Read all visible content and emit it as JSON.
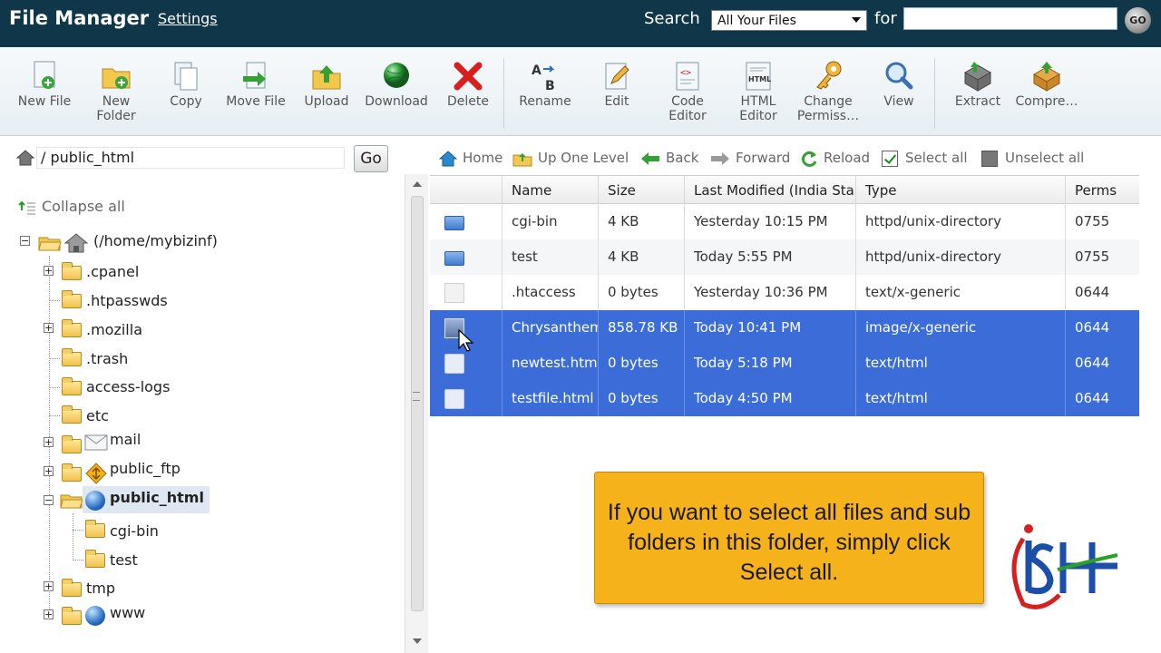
{
  "header": {
    "title": "File Manager",
    "settings_link": "Settings",
    "search_label": "Search",
    "search_scope": "All Your Files",
    "for_label": "for",
    "search_query": "",
    "go_label": "GO"
  },
  "toolbar": {
    "items": [
      {
        "label": "New File",
        "icon": "new-file-icon"
      },
      {
        "label": "New\nFolder",
        "icon": "new-folder-icon"
      },
      {
        "label": "Copy",
        "icon": "copy-icon"
      },
      {
        "label": "Move File",
        "icon": "move-file-icon"
      },
      {
        "label": "Upload",
        "icon": "upload-icon"
      },
      {
        "label": "Download",
        "icon": "download-icon"
      },
      {
        "label": "Delete",
        "icon": "delete-icon"
      },
      {
        "label": "Rename",
        "icon": "rename-icon"
      },
      {
        "label": "Edit",
        "icon": "edit-icon"
      },
      {
        "label": "Code\nEditor",
        "icon": "code-editor-icon"
      },
      {
        "label": "HTML\nEditor",
        "icon": "html-editor-icon"
      },
      {
        "label": "Change\nPermiss…",
        "icon": "change-permissions-icon"
      },
      {
        "label": "View",
        "icon": "view-icon"
      },
      {
        "label": "Extract",
        "icon": "extract-icon"
      },
      {
        "label": "Compre…",
        "icon": "compress-icon"
      }
    ]
  },
  "path": {
    "slash": "/",
    "value": "public_html",
    "go_label": "Go"
  },
  "tree": {
    "collapse_all": "Collapse all",
    "root": "(/home/mybizinf)",
    "items": [
      {
        "label": ".cpanel"
      },
      {
        "label": ".htpasswds"
      },
      {
        "label": ".mozilla"
      },
      {
        "label": ".trash"
      },
      {
        "label": "access-logs"
      },
      {
        "label": "etc"
      },
      {
        "label": "mail"
      },
      {
        "label": "public_ftp"
      },
      {
        "label": "public_html"
      },
      {
        "label": "cgi-bin"
      },
      {
        "label": "test"
      },
      {
        "label": "tmp"
      },
      {
        "label": "www"
      }
    ]
  },
  "nav": {
    "home": "Home",
    "up_one_level": "Up One Level",
    "back": "Back",
    "forward": "Forward",
    "reload": "Reload",
    "select_all": "Select all",
    "unselect_all": "Unselect all"
  },
  "table": {
    "headers": {
      "name": "Name",
      "size": "Size",
      "modified": "Last Modified (India Standard Time)",
      "type": "Type",
      "perms": "Perms"
    },
    "rows": [
      {
        "name": "cgi-bin",
        "size": "4 KB",
        "modified": "Yesterday 10:15 PM",
        "type": "httpd/unix-directory",
        "perms": "0755",
        "icon": "folder-icon",
        "selected": false
      },
      {
        "name": "test",
        "size": "4 KB",
        "modified": "Today 5:55 PM",
        "type": "httpd/unix-directory",
        "perms": "0755",
        "icon": "folder-icon",
        "selected": false
      },
      {
        "name": ".htaccess",
        "size": "0 bytes",
        "modified": "Yesterday 10:36 PM",
        "type": "text/x-generic",
        "perms": "0644",
        "icon": "text-file-icon",
        "selected": false
      },
      {
        "name": "Chrysanthemum.jpg",
        "size": "858.78 KB",
        "modified": "Today 10:41 PM",
        "type": "image/x-generic",
        "perms": "0644",
        "icon": "image-file-icon",
        "selected": true
      },
      {
        "name": "newtest.html",
        "size": "0 bytes",
        "modified": "Today 5:18 PM",
        "type": "text/html",
        "perms": "0644",
        "icon": "html-file-icon",
        "selected": true
      },
      {
        "name": "testfile.html",
        "size": "0 bytes",
        "modified": "Today 4:50 PM",
        "type": "text/html",
        "perms": "0644",
        "icon": "html-file-icon",
        "selected": true
      }
    ]
  },
  "tooltip": {
    "text": "If you want to select all files and sub folders in this folder, simply click Select all."
  },
  "colors": {
    "header_bg": "#0f3649",
    "selection": "#3b6cd8",
    "tooltip_bg": "#f6b21a"
  }
}
